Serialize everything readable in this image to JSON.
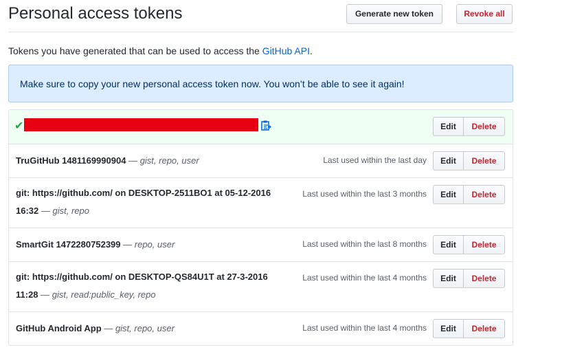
{
  "header": {
    "title": "Personal access tokens",
    "generate_label": "Generate new token",
    "revoke_label": "Revoke all"
  },
  "description": {
    "text": "Tokens you have generated that can be used to access the ",
    "link": "GitHub API",
    "suffix": "."
  },
  "flash": {
    "message": "Make sure to copy your new personal access token now. You won’t be able to see it again!"
  },
  "buttons": {
    "edit": "Edit",
    "delete": "Delete"
  },
  "tokens": [
    {
      "name": "TruGitHub 1481169990904",
      "scopes": "gist, repo, user",
      "last_used": "Last used within the last day"
    },
    {
      "name_line1": "git: https://github.com/ on DESKTOP-2511BO1 at 05-12-2016",
      "name_line2": "16:32",
      "scopes": "gist, repo",
      "last_used": "Last used within the last 3 months"
    },
    {
      "name": "SmartGit 1472280752399",
      "scopes": "repo, user",
      "last_used": "Last used within the last 8 months"
    },
    {
      "name_line1": "git: https://github.com/ on DESKTOP-QS84U1T at 27-3-2016",
      "name_line2": "11:28",
      "scopes": "gist, read:public_key, repo",
      "last_used": "Last used within the last 4 months"
    },
    {
      "name": "GitHub Android App",
      "scopes": "gist, repo, user",
      "last_used": "Last used within the last 4 months"
    }
  ],
  "separator": "—",
  "colors": {
    "link": "#0366d6",
    "danger": "#cb2431",
    "success": "#28a745",
    "redaction": "#e60012"
  }
}
